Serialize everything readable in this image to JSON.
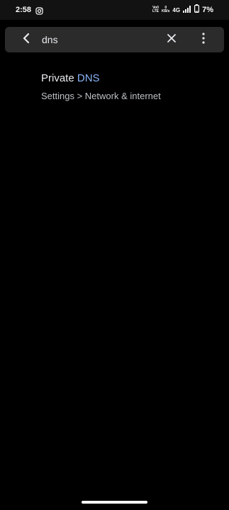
{
  "status_bar": {
    "time": "2:58",
    "instagram_icon": "instagram-icon",
    "volte_line1": "Vo0",
    "volte_line2": "LTE",
    "speed_value": "0",
    "speed_unit": "KB/s",
    "network": "4G",
    "battery_percent": "7%",
    "signal_icon": "signal-icon",
    "battery_icon": "battery-icon"
  },
  "search": {
    "query": "dns",
    "back_icon": "back-arrow-icon",
    "clear_icon": "close-icon",
    "more_icon": "more-vert-icon"
  },
  "results": [
    {
      "title_prefix": "Private ",
      "title_match": "DNS",
      "path": "Settings > Network & internet"
    }
  ],
  "colors": {
    "background": "#000000",
    "search_bar": "#2b2b2b",
    "match_highlight": "#8ab4f8",
    "primary_text": "#e8eaed",
    "secondary_text": "#bdc1c6"
  }
}
